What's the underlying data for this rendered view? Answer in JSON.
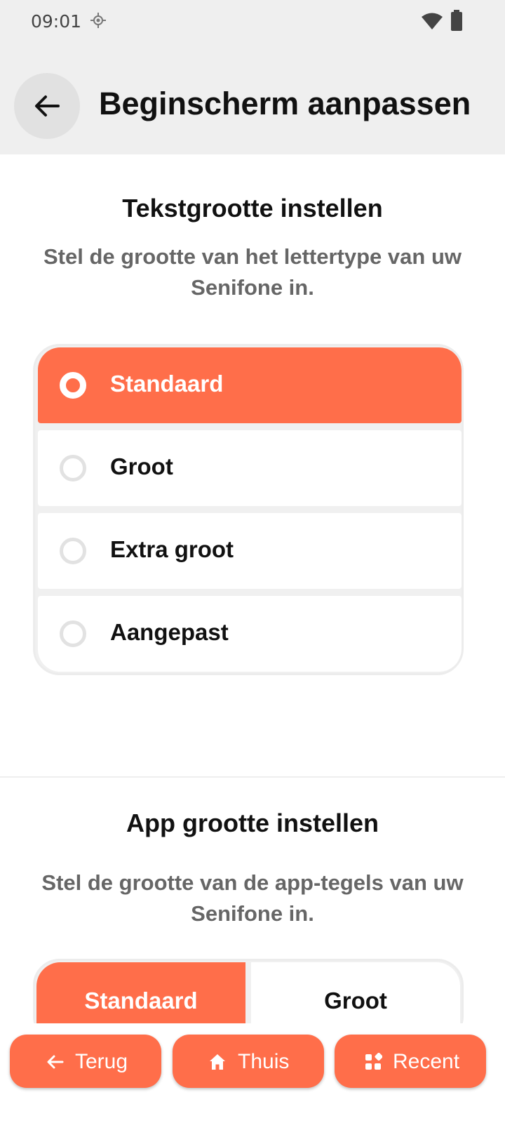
{
  "status_bar": {
    "time": "09:01",
    "icons": [
      "location-icon",
      "wifi-icon",
      "battery-icon"
    ]
  },
  "header": {
    "title": "Beginscherm aanpassen",
    "back_icon": "arrow-left-icon"
  },
  "text_size": {
    "title": "Tekstgrootte instellen",
    "description": "Stel de grootte van het lettertype van uw Senifone in.",
    "options": [
      {
        "label": "Standaard",
        "selected": true
      },
      {
        "label": "Groot",
        "selected": false
      },
      {
        "label": "Extra groot",
        "selected": false
      },
      {
        "label": "Aangepast",
        "selected": false
      }
    ]
  },
  "app_size": {
    "title": "App grootte instellen",
    "description": "Stel de grootte van de app-tegels van uw Senifone in.",
    "options": [
      {
        "label": "Standaard",
        "selected": true
      },
      {
        "label": "Groot",
        "selected": false
      }
    ]
  },
  "bottom_nav": {
    "back": {
      "label": "Terug",
      "icon": "arrow-left-icon"
    },
    "home": {
      "label": "Thuis",
      "icon": "home-icon"
    },
    "recent": {
      "label": "Recent",
      "icon": "apps-grid-icon"
    }
  },
  "colors": {
    "accent": "#ff6e4a",
    "header_bg": "#efefef",
    "text_primary": "#111111",
    "text_secondary": "#666666"
  }
}
